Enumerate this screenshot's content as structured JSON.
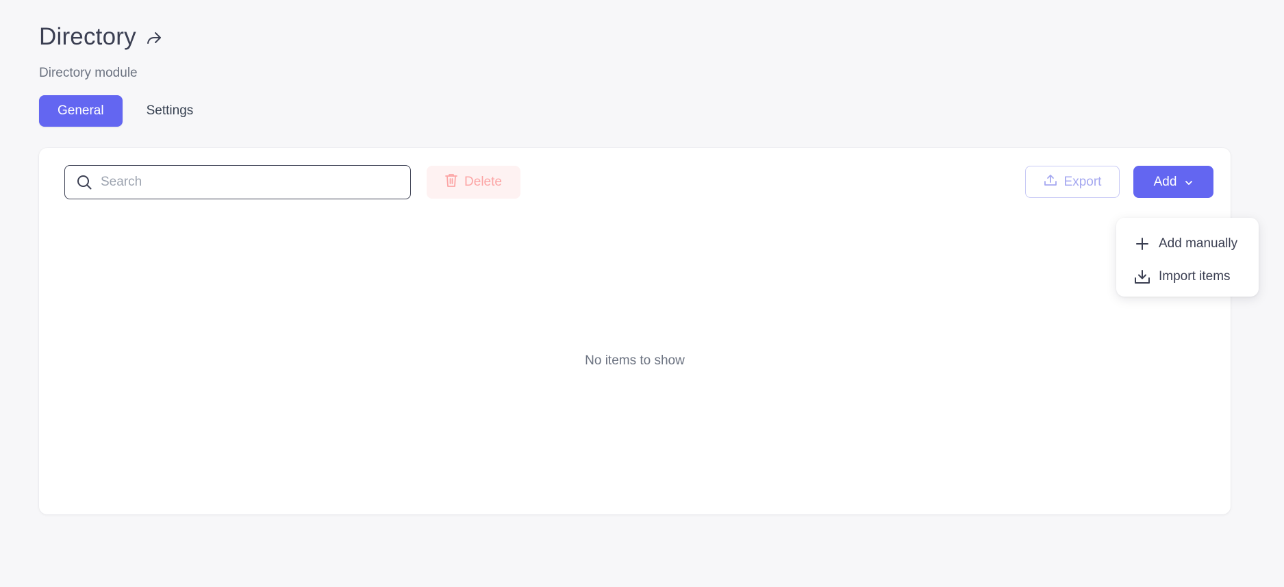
{
  "header": {
    "title": "Directory",
    "subtitle": "Directory module"
  },
  "tabs": [
    {
      "label": "General",
      "active": true
    },
    {
      "label": "Settings",
      "active": false
    }
  ],
  "toolbar": {
    "search_placeholder": "Search",
    "search_value": "",
    "delete_label": "Delete",
    "export_label": "Export",
    "add_label": "Add"
  },
  "list": {
    "empty_text": "No items to show"
  },
  "add_menu": {
    "items": [
      {
        "label": "Add manually",
        "icon": "plus-icon"
      },
      {
        "label": "Import items",
        "icon": "download-tray-icon"
      }
    ]
  },
  "colors": {
    "primary": "#6366f1",
    "background": "#f7f7f9",
    "danger_soft_bg": "#fef2f2",
    "danger_soft_text": "#fca5a5",
    "text_dark": "#3b3f52",
    "text_muted": "#6b7280"
  }
}
